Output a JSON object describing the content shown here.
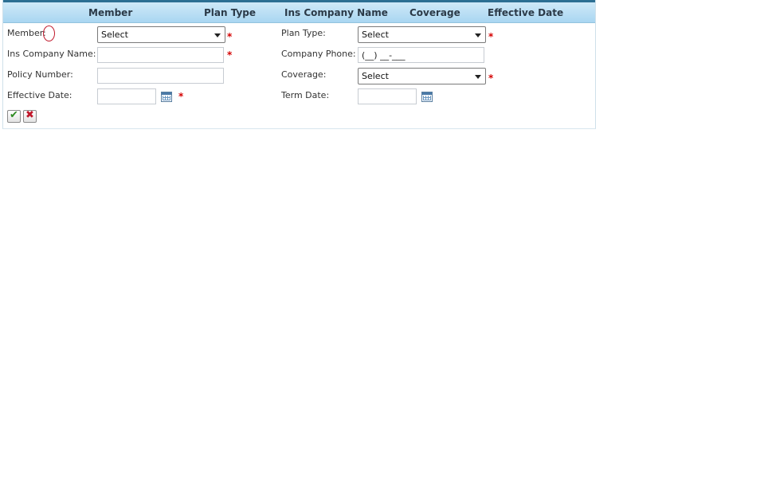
{
  "header": {
    "columns": [
      "Member",
      "Plan Type",
      "Ins Company Name",
      "Coverage",
      "Effective Date"
    ]
  },
  "form": {
    "member_label": "Member:",
    "member_value": "Select",
    "plan_type_label": "Plan Type:",
    "plan_type_value": "Select",
    "ins_company_label": "Ins Company Name:",
    "ins_company_value": "",
    "company_phone_label": "Company Phone:",
    "company_phone_mask": "(__) __-___",
    "policy_number_label": "Policy Number:",
    "policy_number_value": "",
    "coverage_label": "Coverage:",
    "coverage_value": "Select",
    "effective_date_label": "Effective Date:",
    "effective_date_value": "",
    "term_date_label": "Term Date:",
    "term_date_value": "",
    "required_marker": "*"
  },
  "actions": {
    "save_icon": "check-icon",
    "cancel_icon": "x-icon",
    "save_glyph": "✔",
    "cancel_glyph": "✖"
  },
  "colors": {
    "header_top": "#cfe9f8",
    "header_bottom": "#a9d6f1",
    "required": "#d40000",
    "check": "#2e8b22",
    "cancel": "#c0182b",
    "annotation": "#c0182b"
  }
}
